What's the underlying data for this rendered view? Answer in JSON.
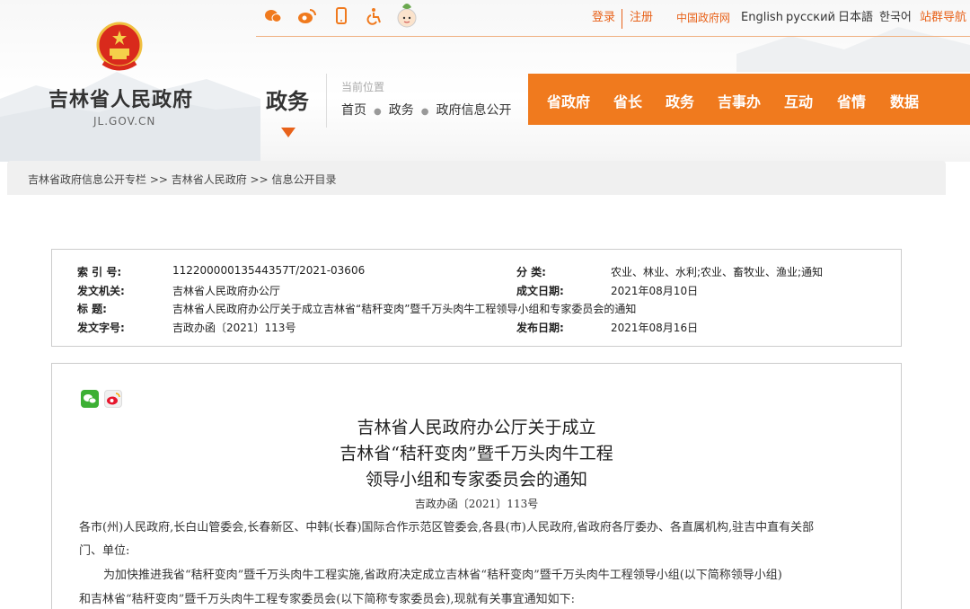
{
  "topbar": {
    "login": "登录",
    "register": "注册",
    "links": [
      "中国政府网",
      "English",
      "русский",
      "日本語",
      "한국어",
      "站群导航"
    ]
  },
  "header": {
    "site_name": "吉林省人民政府",
    "site_domain": "JL.GOV.CN",
    "section": "政务",
    "location_label": "当前位置",
    "crumbs": [
      "首页",
      "政务",
      "政府信息公开"
    ]
  },
  "nav": [
    "省政府",
    "省长",
    "政务",
    "吉事办",
    "互动",
    "省情",
    "数据"
  ],
  "breadcrumb": "吉林省政府信息公开专栏 >> 吉林省人民政府 >> 信息公开目录",
  "meta": {
    "index_label": "索 引 号:",
    "index_value": "11220000013544357T/2021-03606",
    "category_label": "分 类:",
    "category_value": "农业、林业、水利;农业、畜牧业、渔业;通知",
    "issuer_label": "发文机关:",
    "issuer_value": "吉林省人民政府办公厅",
    "date_label": "成文日期:",
    "date_value": "2021年08月10日",
    "title_label": "标 题:",
    "title_value": "吉林省人民政府办公厅关于成立吉林省“秸秆变肉”暨千万头肉牛工程领导小组和专家委员会的通知",
    "docno_label": "发文字号:",
    "docno_value": "吉政办函〔2021〕113号",
    "publish_label": "发布日期:",
    "publish_value": "2021年08月16日"
  },
  "article": {
    "title_lines": [
      "吉林省人民政府办公厅关于成立",
      "吉林省“秸秆变肉”暨千万头肉牛工程",
      "领导小组和专家委员会的通知"
    ],
    "docno": "吉政办函〔2021〕113号",
    "paragraphs": [
      "各市(州)人民政府,长白山管委会,长春新区、中韩(长春)国际合作示范区管委会,各县(市)人民政府,省政府各厅委办、各直属机构,驻吉中直有关部",
      "门、单位:",
      "为加快推进我省“秸秆变肉”暨千万头肉牛工程实施,省政府决定成立吉林省“秸秆变肉”暨千万头肉牛工程领导小组(以下简称领导小组)",
      "和吉林省“秸秆变肉”暨千万头肉牛工程专家委员会(以下简称专家委员会),现就有关事宜通知如下:"
    ]
  },
  "colors": {
    "accent": "#f07a1e",
    "link_orange": "#e8621a",
    "wechat": "#3cb034"
  },
  "icons": [
    "wechat-icon",
    "weibo-icon",
    "mobile-icon",
    "accessibility-icon",
    "mascot-icon",
    "national-emblem-icon",
    "share-wechat-icon",
    "share-weibo-icon"
  ]
}
